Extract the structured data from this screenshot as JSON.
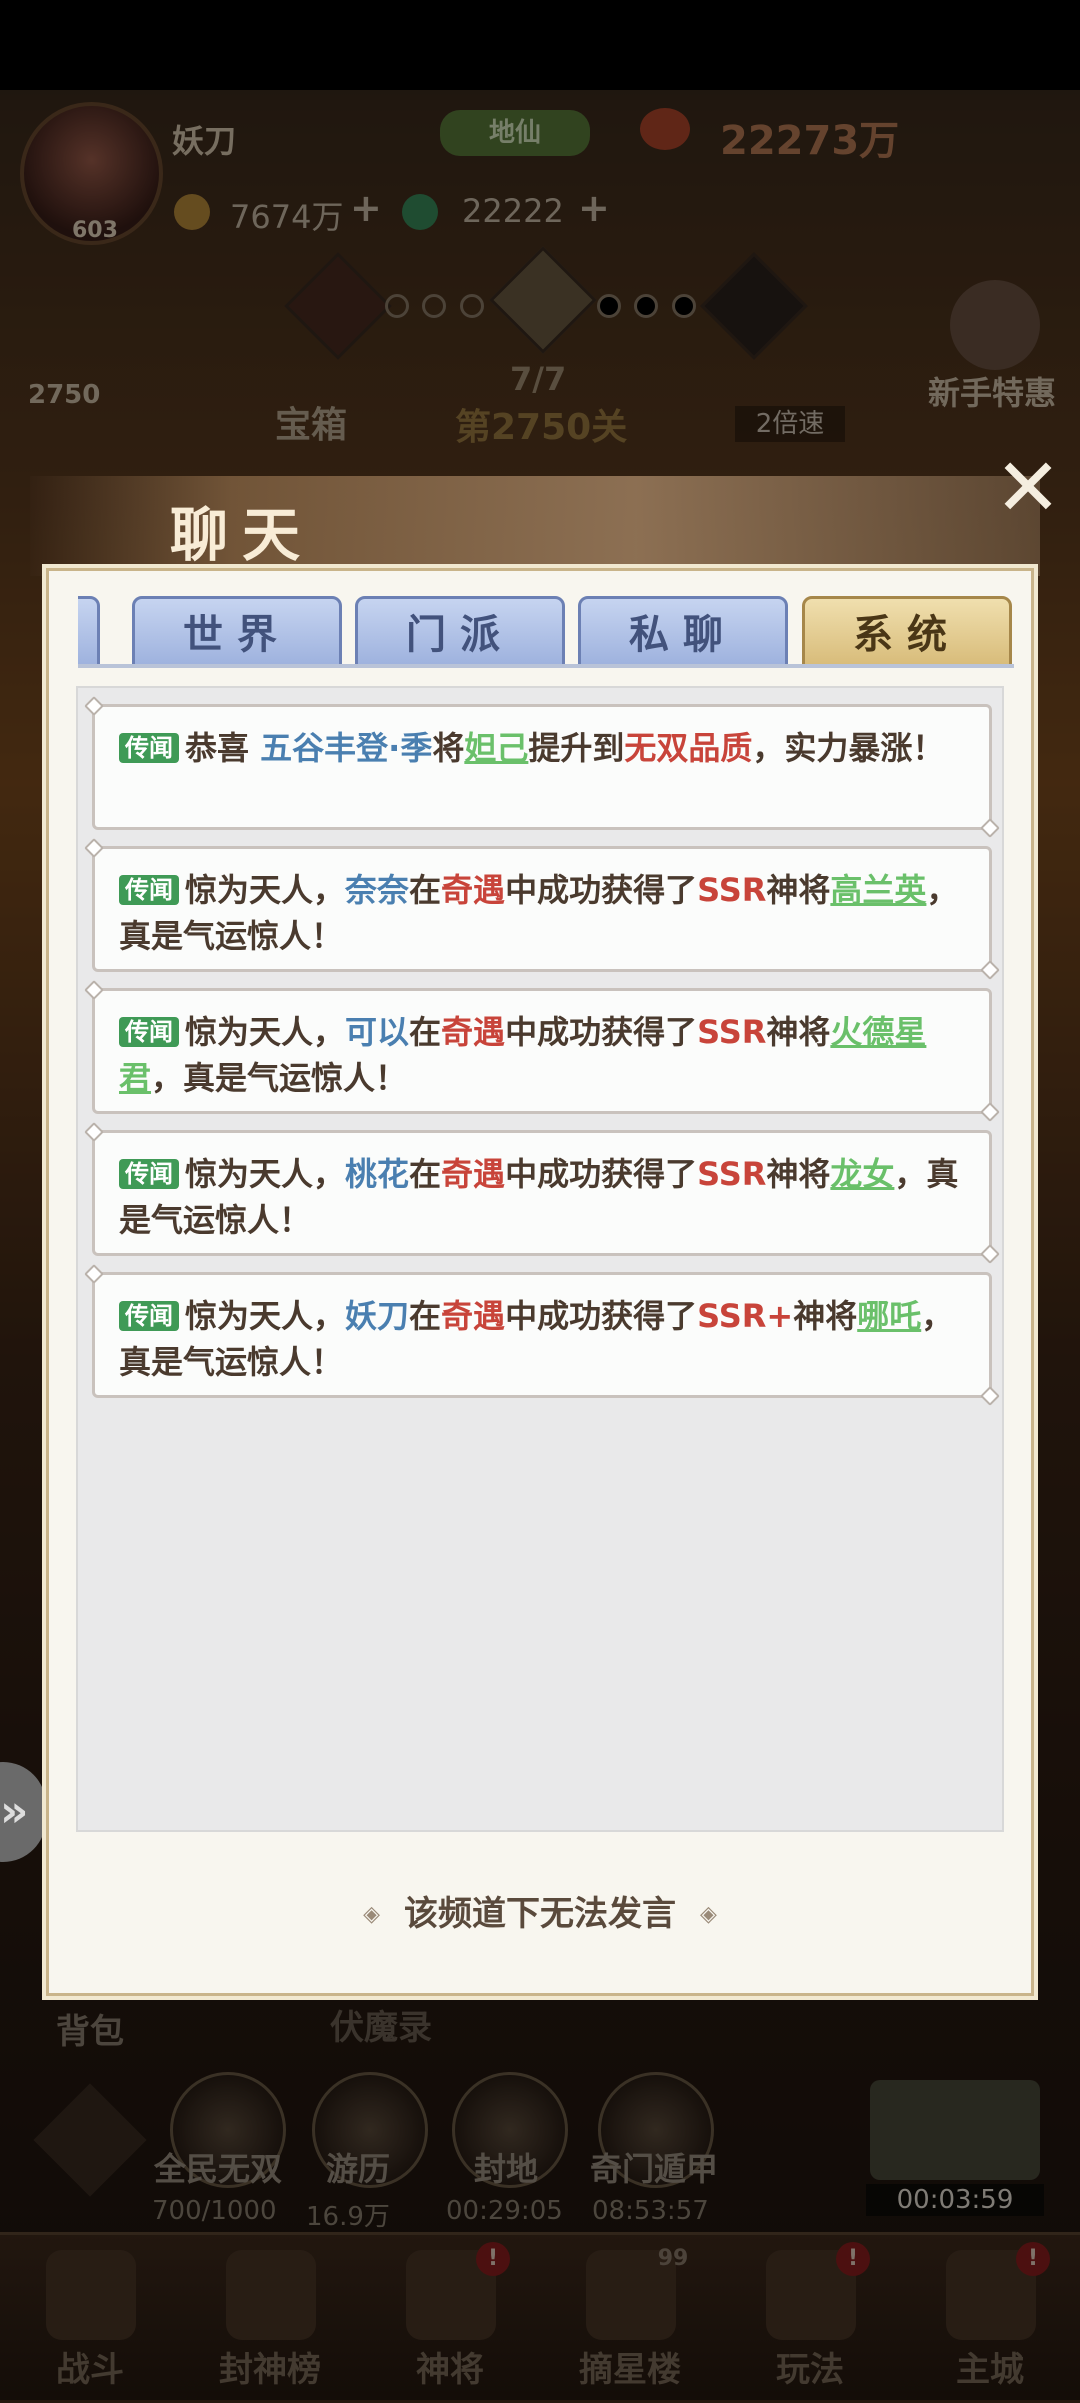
{
  "player": {
    "name": "妖刀",
    "level": "603",
    "rank": "地仙",
    "power": "22273万",
    "currency1": "7674万",
    "currency2": "22222",
    "plus": "+"
  },
  "stage": {
    "progress": "7/7",
    "label": "第2750关",
    "chest": "宝箱",
    "speed": "2倍速",
    "left_count": "2750"
  },
  "side": {
    "newbie_offer": "新手特惠",
    "backpack": "背包",
    "fumolu": "伏魔录"
  },
  "features": [
    {
      "label": "全民无双",
      "sub": "700/1000"
    },
    {
      "label": "游历",
      "sub": "16.9万"
    },
    {
      "label": "封地",
      "sub": "00:29:05"
    },
    {
      "label": "奇门遁甲",
      "sub": "08:53:57"
    }
  ],
  "timer": "00:03:59",
  "bottom_nav": [
    {
      "label": "战斗",
      "badge": ""
    },
    {
      "label": "封神榜",
      "badge": ""
    },
    {
      "label": "神将",
      "badge": "!"
    },
    {
      "label": "摘星楼",
      "badge": "99"
    },
    {
      "label": "玩法",
      "badge": "!"
    },
    {
      "label": "主城",
      "badge": "!"
    }
  ],
  "chat": {
    "title": "聊天",
    "close_glyph": "✕",
    "tabs": [
      {
        "label": "世界",
        "active": false
      },
      {
        "label": "门派",
        "active": false
      },
      {
        "label": "私聊",
        "active": false
      },
      {
        "label": "系统",
        "active": true
      }
    ],
    "tag": "传闻",
    "messages": [
      {
        "prefix": "恭喜",
        "name": "五谷丰登·季",
        "mid1": "将",
        "item": "妲己",
        "mid2": "提升到",
        "quality": "无双品质",
        "suffix": "，实力暴涨！"
      },
      {
        "prefix": "惊为天人，",
        "name": "奈奈",
        "mid1": "在",
        "place": "奇遇",
        "mid2": "中成功获得了",
        "grade": "SSR",
        "mid3": "神将",
        "hero": "高兰英",
        "suffix": "，真是气运惊人！"
      },
      {
        "prefix": "惊为天人，",
        "name": "可以",
        "mid1": "在",
        "place": "奇遇",
        "mid2": "中成功获得了",
        "grade": "SSR",
        "mid3": "神将",
        "hero": "火德星君",
        "suffix": "，真是气运惊人！"
      },
      {
        "prefix": "惊为天人，",
        "name": "桃花",
        "mid1": "在",
        "place": "奇遇",
        "mid2": "中成功获得了",
        "grade": "SSR",
        "mid3": "神将",
        "hero": "龙女",
        "suffix": "，真是气运惊人！"
      },
      {
        "prefix": "惊为天人，",
        "name": "妖刀",
        "mid1": "在",
        "place": "奇遇",
        "mid2": "中成功获得了",
        "grade": "SSR+",
        "mid3": "神将",
        "hero": "哪吒",
        "suffix": "，真是气运惊人！"
      }
    ],
    "no_speak": "该频道下无法发言",
    "deco_left": "◈",
    "deco_right": "◈"
  },
  "icons": {
    "close": "close-icon",
    "side_arrow": "chevron-right-icon"
  }
}
